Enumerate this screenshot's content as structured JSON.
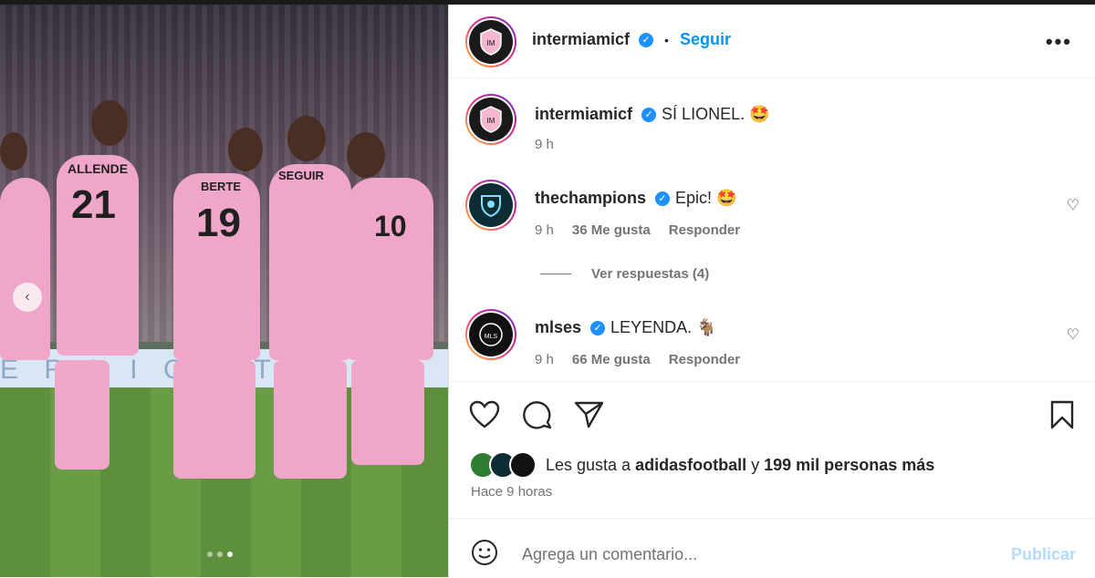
{
  "media": {
    "board_text": "E  R  L I C H T",
    "players": [
      "21",
      "19",
      "10"
    ],
    "players_names": [
      "ALLENDE",
      "BERTE",
      "SEGUIR"
    ],
    "carousel": {
      "count": 3,
      "active": 3
    }
  },
  "header": {
    "username": "intermiamicf",
    "separator": "•",
    "follow_label": "Seguir",
    "more_label": "•••"
  },
  "caption": {
    "username": "intermiamicf",
    "text": "SÍ LIONEL. 🤩",
    "time": "9 h"
  },
  "comments": [
    {
      "username": "thechampions",
      "text": "Epic! 🤩",
      "time": "9 h",
      "likes": "36 Me gusta",
      "reply": "Responder"
    },
    {
      "username": "mlses",
      "text": "LEYENDA. 🐐",
      "time": "9 h",
      "likes": "66 Me gusta",
      "reply": "Responder"
    }
  ],
  "view_replies": "Ver respuestas (4)",
  "likes": {
    "prefix": "Les gusta a",
    "user": "adidasfootball",
    "middle": "y",
    "count": "199 mil personas más"
  },
  "time_ago": "Hace 9 horas",
  "comment_box": {
    "placeholder": "Agrega un comentario...",
    "publish": "Publicar"
  },
  "icons": {
    "like": "heart-icon",
    "comment": "comment-icon",
    "share": "share-icon",
    "save": "bookmark-icon",
    "emoji": "emoji-icon"
  },
  "colors": {
    "accent": "#0095f6",
    "verified": "#1e90ff",
    "jersey": "#f0a6c8"
  }
}
